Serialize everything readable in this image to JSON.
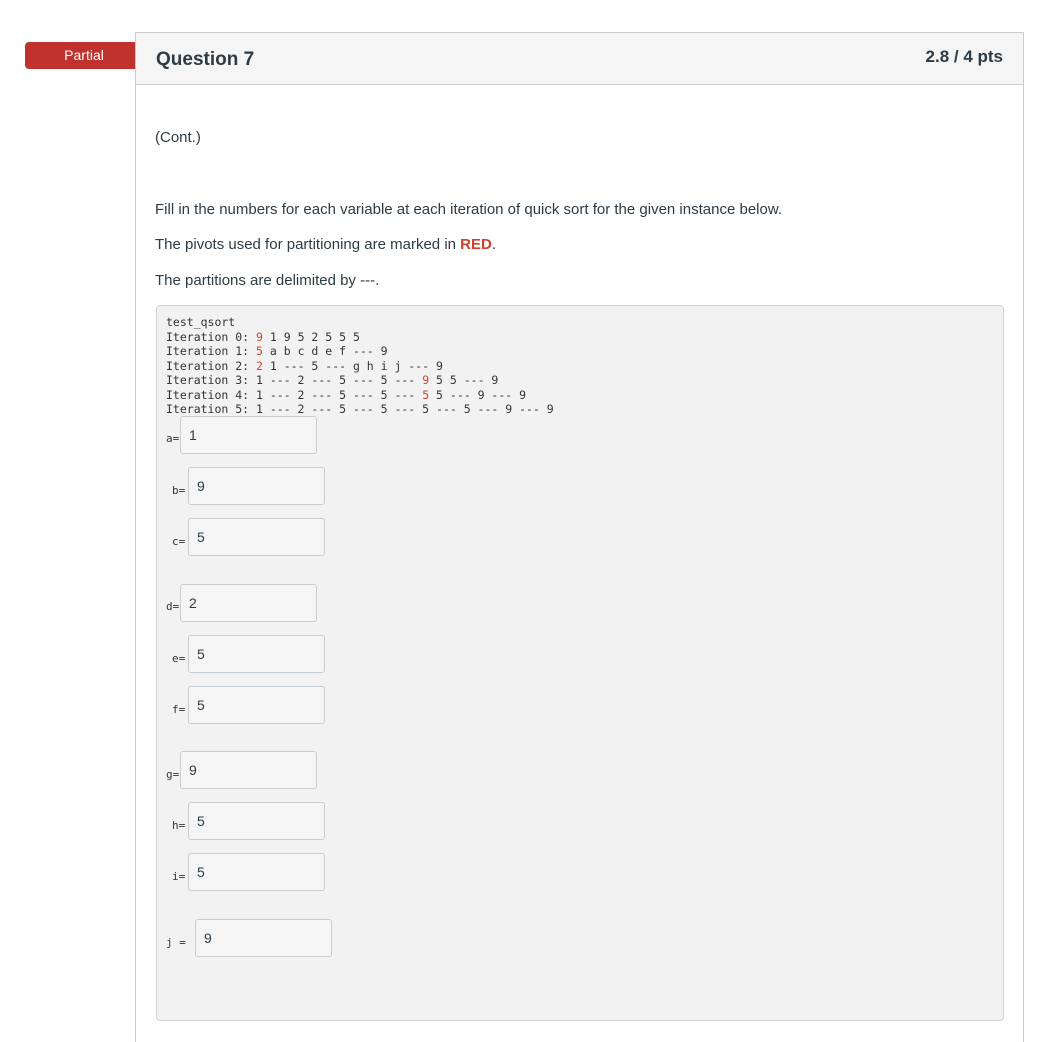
{
  "status_badge": "Partial",
  "question": {
    "title": "Question 7",
    "points": "2.8 / 4 pts",
    "cont": "(Cont.)",
    "instruction": "Fill in the numbers for each variable at each iteration of quick sort for the given instance below.",
    "pivot_note_prefix": "The pivots used for partitioning are marked in ",
    "pivot_note_red": "RED",
    "pivot_note_suffix": ".",
    "partition_note": "The partitions are delimited by ---."
  },
  "code": {
    "header": "test_qsort",
    "lines": [
      {
        "prefix": "Iteration 0: ",
        "pivot": "9",
        "rest": " 1 9 5 2 5 5 5"
      },
      {
        "prefix": "Iteration 1: ",
        "pivot": "5",
        "rest": " a b c d e f --- 9"
      },
      {
        "prefix": "Iteration 2: ",
        "pivot": "2",
        "rest": " 1 --- 5 --- g h i j --- 9"
      },
      {
        "prefix": "Iteration 3: 1 --- 2 --- 5 --- 5 --- ",
        "pivot": "9",
        "rest": " 5 5 --- 9"
      },
      {
        "prefix": "Iteration 4: 1 --- 2 --- 5 --- 5 --- ",
        "pivot": "5",
        "rest": " 5 --- 9 --- 9"
      },
      {
        "prefix": "Iteration 5: 1 --- 2 --- 5 --- 5 --- 5 --- 5 --- 9 --- 9",
        "pivot": "",
        "rest": ""
      }
    ]
  },
  "answers": [
    {
      "label": "a=",
      "value": "1"
    },
    {
      "label": "b=",
      "value": "9"
    },
    {
      "label": "c=",
      "value": "5"
    },
    {
      "label": "d=",
      "value": "2"
    },
    {
      "label": "e=",
      "value": "5"
    },
    {
      "label": "f=",
      "value": "5"
    },
    {
      "label": "g=",
      "value": "9"
    },
    {
      "label": "h=",
      "value": "5"
    },
    {
      "label": "i=",
      "value": "5"
    },
    {
      "label": "j =",
      "value": "9"
    }
  ],
  "colors": {
    "badge": "#c0322d",
    "pivot": "#d2402f",
    "panel": "#f2f2f2"
  }
}
